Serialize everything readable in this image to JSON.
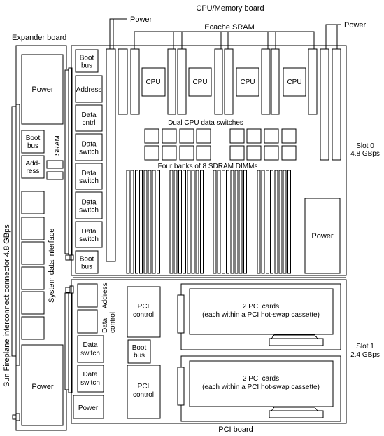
{
  "title": "CPU/Memory board",
  "labels": {
    "cpu_board": "CPU/Memory board",
    "expander_board": "Expander board",
    "pci_board": "PCI board",
    "power_top_left": "Power",
    "power_top_right": "Power",
    "ecache_sram": "Ecache SRAM",
    "dual_cpu_switches": "Dual CPU data switches",
    "sdram_dimms": "Four banks of 8 SDRAM DIMMs",
    "slot0_line1": "Slot 0",
    "slot0_line2": "4.8 GBps",
    "slot1_line1": "Slot 1",
    "slot1_line2": "2.4 GBps",
    "fireplane": "Sun Fireplane interconnect connector 4.8 GBps",
    "sram_vertical": "SRAM",
    "system_data_interface": "System data interface"
  },
  "expander": {
    "power_top": "Power",
    "boot_bus": [
      "Boot",
      "bus"
    ],
    "address": [
      "Add-",
      "ress"
    ],
    "power_bottom": "Power"
  },
  "cpu_board": {
    "left_column": [
      {
        "lines": [
          "Boot",
          "bus"
        ]
      },
      {
        "lines": [
          "Address"
        ]
      },
      {
        "lines": [
          "Data",
          "cntrl"
        ]
      },
      {
        "lines": [
          "Data",
          "switch"
        ]
      },
      {
        "lines": [
          "Data",
          "switch"
        ]
      },
      {
        "lines": [
          "Data",
          "switch"
        ]
      },
      {
        "lines": [
          "Data",
          "switch"
        ]
      },
      {
        "lines": [
          "Boot",
          "bus"
        ]
      }
    ],
    "cpus": [
      "CPU",
      "CPU",
      "CPU",
      "CPU"
    ],
    "power": "Power",
    "dimm_banks": 4,
    "dimms_per_bank": 8
  },
  "pci_board": {
    "address": "Address",
    "data_control": [
      "Data",
      "control"
    ],
    "data_switch_1": [
      "Data",
      "switch"
    ],
    "data_switch_2": [
      "Data",
      "switch"
    ],
    "power": "Power",
    "pci_control_1": [
      "PCI",
      "control"
    ],
    "boot_bus": [
      "Boot",
      "bus"
    ],
    "pci_control_2": [
      "PCI",
      "control"
    ],
    "pci_cards_1": [
      "2 PCI cards",
      "(each within a PCI hot-swap cassette)"
    ],
    "pci_cards_2": [
      "2 PCI cards",
      "(each within a PCI hot-swap cassette)"
    ]
  }
}
